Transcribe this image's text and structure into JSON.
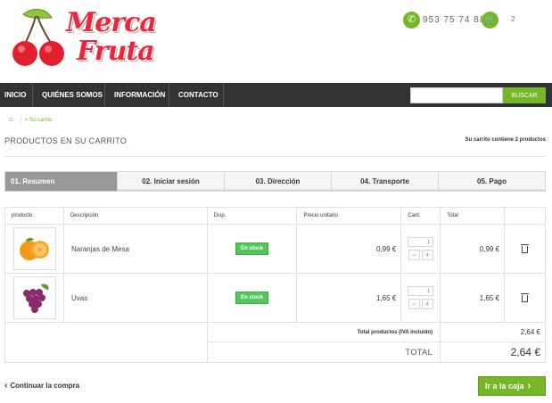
{
  "header": {
    "logo_line1": "Merca",
    "logo_line2": "Fruta",
    "phone": "953 75 74 88",
    "cart_count": "2"
  },
  "nav": {
    "items": [
      "INICIO",
      "QUIÉNES SOMOS",
      "INFORMACIÓN",
      "CONTACTO"
    ],
    "search_button": "BUSCAR",
    "search_placeholder": ""
  },
  "breadcrumb": {
    "current": "> Su carrito"
  },
  "page": {
    "title": "PRODUCTOS EN SU CARRITO",
    "summary": "Su carrito contiene 2 productos"
  },
  "steps": [
    "01. Resumen",
    "02. Iniciar sesión",
    "03. Dirección",
    "04. Transporte",
    "05. Pago"
  ],
  "table": {
    "headers": [
      "producto",
      "Descripción",
      "Disp.",
      "Precio unitario",
      "Cant.",
      "Total"
    ],
    "rows": [
      {
        "description": "Naranjas de Mesa",
        "stock": "En stock",
        "unit_price": "0,99 €",
        "qty": "1",
        "total": "0,99 €"
      },
      {
        "description": "Uvas",
        "stock": "En stock",
        "unit_price": "1,65 €",
        "qty": "1",
        "total": "1,65 €"
      }
    ],
    "total_products_label": "Total productos (IVA incluido)",
    "total_products_value": "2,64 €",
    "total_label": "TOTAL",
    "total_value": "2,64 €"
  },
  "actions": {
    "continue": "Continuar la compra",
    "checkout": "Ir a la caja"
  },
  "colors": {
    "accent": "#76b729",
    "nav_bg": "#333333",
    "stock": "#55c65e",
    "logo": "#e8283c"
  }
}
